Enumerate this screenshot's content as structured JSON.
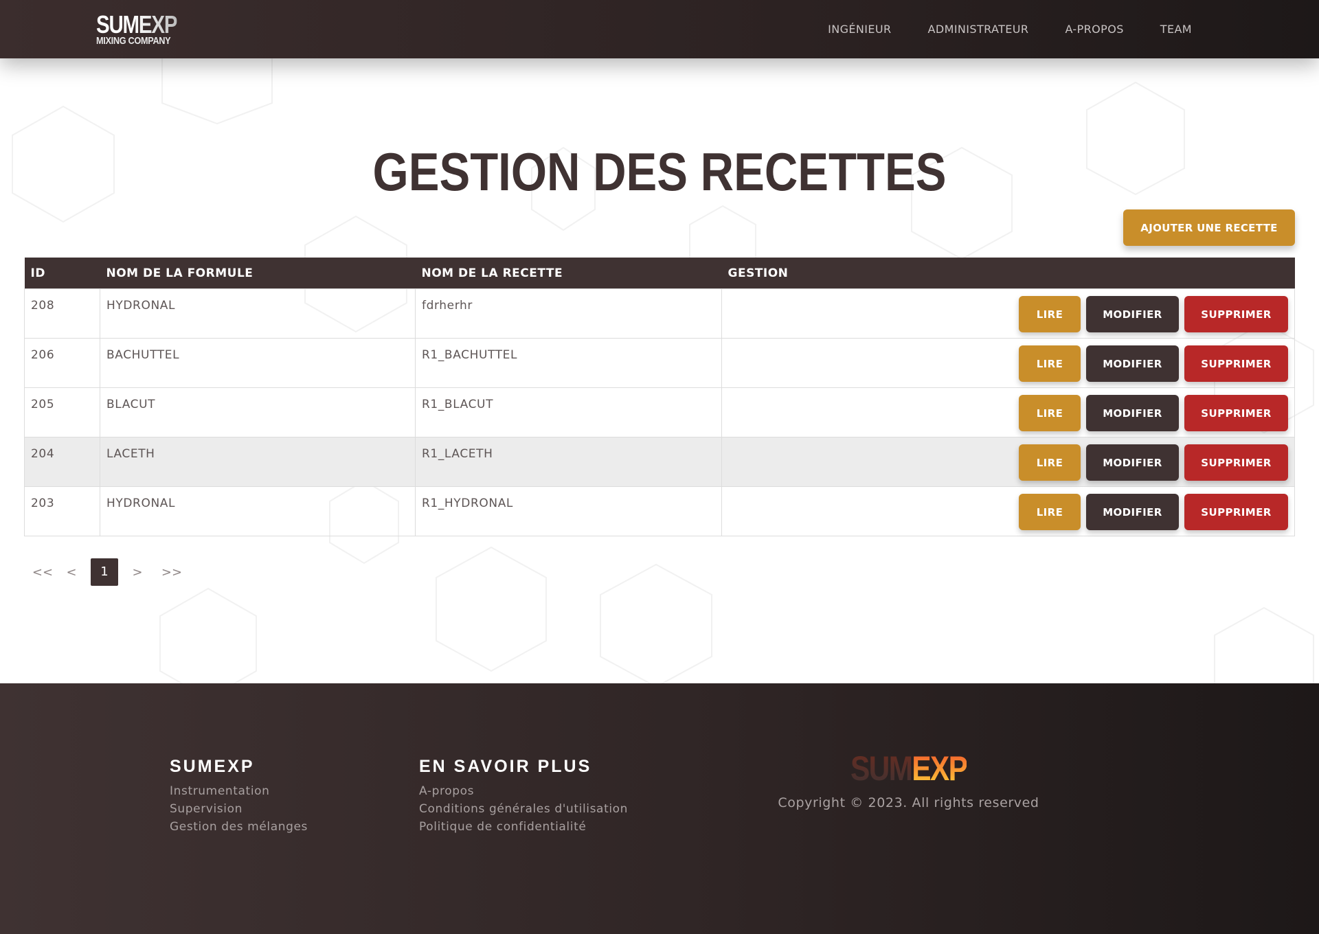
{
  "header": {
    "logo_main": "SUMEXP",
    "logo_sub": "MIXING COMPANY",
    "nav": [
      "INGÉNIEUR",
      "ADMINISTRATEUR",
      "A-PROPOS",
      "TEAM"
    ]
  },
  "main": {
    "title": "GESTION DES RECETTES",
    "add_button": "AJOUTER UNE RECETTE",
    "table": {
      "headers": [
        "ID",
        "NOM DE LA FORMULE",
        "NOM DE LA RECETTE",
        "GESTION"
      ],
      "rows": [
        {
          "id": "208",
          "formule": "HYDRONAL",
          "recette": "fdrherhr"
        },
        {
          "id": "206",
          "formule": "BACHUTTEL",
          "recette": "R1_BACHUTTEL"
        },
        {
          "id": "205",
          "formule": "BLACUT",
          "recette": "R1_BLACUT"
        },
        {
          "id": "204",
          "formule": "LACETH",
          "recette": "R1_LACETH"
        },
        {
          "id": "203",
          "formule": "HYDRONAL",
          "recette": "R1_HYDRONAL"
        }
      ],
      "actions": {
        "read": "LIRE",
        "edit": "MODIFIER",
        "delete": "SUPPRIMER"
      }
    },
    "pagination": {
      "first": "<<",
      "prev": "<",
      "current": "1",
      "next": ">",
      "last": ">>"
    }
  },
  "footer": {
    "col1": {
      "title": "SUMEXP",
      "links": [
        "Instrumentation",
        "Supervision",
        "Gestion des mélanges"
      ]
    },
    "col2": {
      "title": "EN SAVOIR PLUS",
      "links": [
        "A-propos",
        "Conditions générales d'utilisation",
        "Politique de confidentialité"
      ]
    },
    "brand_a": "SUM",
    "brand_b": "EXP",
    "copyright": "Copyright © 2023. All rights reserved"
  },
  "colors": {
    "primary": "#3f3232",
    "accent": "#c98e2a",
    "danger": "#b82828"
  }
}
